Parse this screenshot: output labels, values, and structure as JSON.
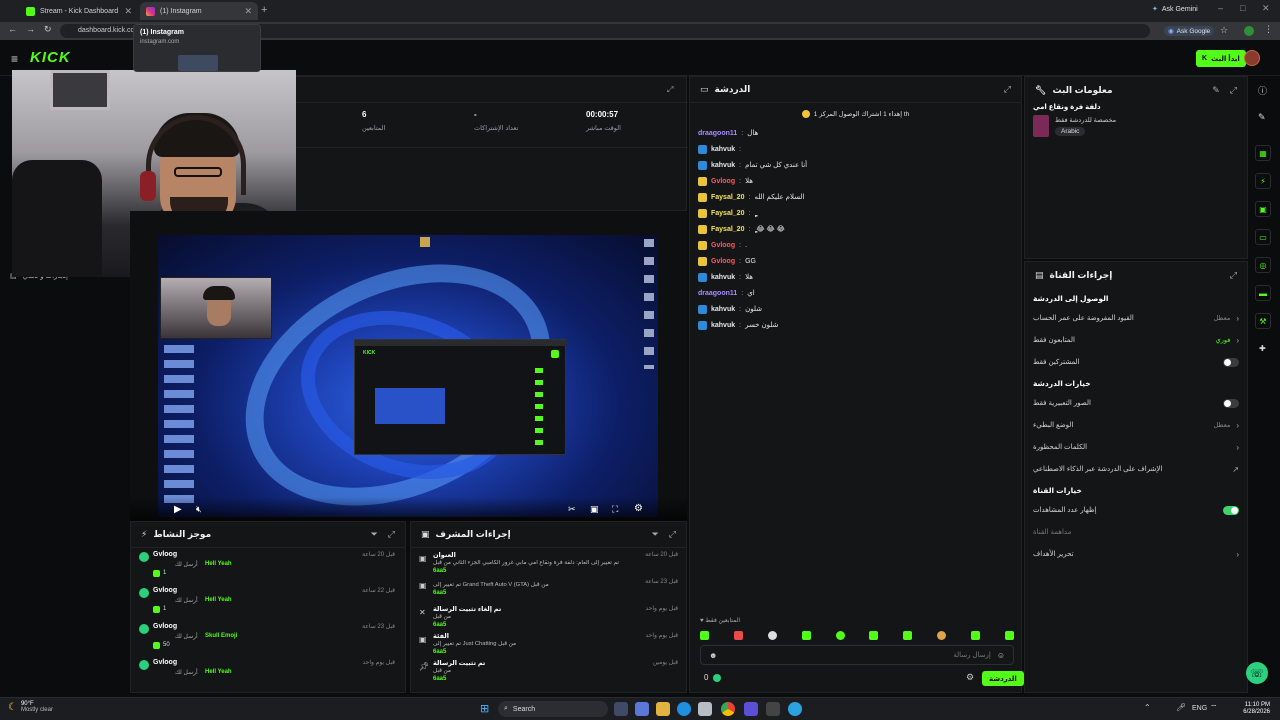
{
  "browser": {
    "tabs": [
      {
        "label": "Stream - Kick Dashboard",
        "active": false
      },
      {
        "label": "(1) Instagram",
        "active": true
      }
    ],
    "url": "dashboard.kick.co",
    "ask_gemini": "Ask Gemini",
    "ask_google": "Ask Google",
    "tooltip": {
      "title": "(1) Instagram",
      "domain": "instagram.com"
    }
  },
  "kick": {
    "logo": "KICK",
    "go_live_label": "ابدأ البث",
    "stats": [
      {
        "value": "00:00:57",
        "label": "الوقت مباشر"
      },
      {
        "value": "-",
        "label": "تعداد الإشتراكات"
      },
      {
        "value": "6",
        "label": "المتابعين"
      }
    ],
    "left_menu_item": "إنجازات و تحدي"
  },
  "chat": {
    "title": "الدردشة",
    "pinned": "إهداء 1 اشتراك الوصول المركز 1 th",
    "messages": [
      {
        "user": "draagoon11",
        "text": "هال",
        "color": "#a98bff"
      },
      {
        "user": "kahvuk",
        "text": "",
        "color": "#e6e6e6"
      },
      {
        "user": "kahvuk",
        "text": "أنا عندي كل شي تمام",
        "color": "#e6e6e6"
      },
      {
        "user": "Gvloog",
        "text": "هلا",
        "color": "#ff5a5a"
      },
      {
        "user": "Faysal_20",
        "text": "السلام عليكم الله",
        "color": "#f5e663"
      },
      {
        "user": "Faysal_20",
        "text": "ٍٍٍٍٍٍٍٍٍٍٍ",
        "color": "#f5e663"
      },
      {
        "user": "Faysal_20",
        "text": "ٍٍٍٍٍ 😂 😂 😂",
        "color": "#f5e663"
      },
      {
        "user": "Gvloog",
        "text": ".",
        "color": "#ff5a5a"
      },
      {
        "user": "Gvloog",
        "text": "GG",
        "color": "#ff5a5a"
      },
      {
        "user": "kahvuk",
        "text": "هلا",
        "color": "#e6e6e6"
      },
      {
        "user": "draagoon11",
        "text": "اي",
        "color": "#a98bff"
      },
      {
        "user": "kahvuk",
        "text": "شلون",
        "color": "#e6e6e6"
      },
      {
        "user": "kahvuk",
        "text": "شلون خسر",
        "color": "#e6e6e6"
      }
    ],
    "followers_only": "المتابعين فقط",
    "input_placeholder": "إرسال رسالة",
    "send_label": "الدردشة",
    "count": "0"
  },
  "stream_info": {
    "title": "معلومات البث",
    "stream_title": "دلفة فرة ونقاع امي",
    "category": "مخصصة للدردشة فقط",
    "language": "Arabic"
  },
  "channel_actions": {
    "title": "إجراءات القناة",
    "sections": [
      {
        "heading": "الوصول إلى الدردشة",
        "rows": [
          {
            "label": "القيود المفروضة على عمر الحساب",
            "value": "معطل",
            "type": "arrow"
          },
          {
            "label": "المتابعون فقط",
            "value": "فوري",
            "type": "arrow-green"
          },
          {
            "label": "المشتركين فقط",
            "value": "",
            "type": "toggle-off"
          }
        ]
      },
      {
        "heading": "خيارات الدردشة",
        "rows": [
          {
            "label": "الصور التعبيرية فقط",
            "value": "",
            "type": "toggle-off"
          },
          {
            "label": "الوضع البطيء",
            "value": "معطل",
            "type": "arrow"
          },
          {
            "label": "الكلمات المحظورة",
            "value": "",
            "type": "arrow"
          },
          {
            "label": "الإشراف على الدردشة عبر الذكاء الاصطناعي",
            "value": "",
            "type": "ext"
          }
        ]
      },
      {
        "heading": "خيارات القناة",
        "rows": [
          {
            "label": "إظهار عدد المشاهدات",
            "value": "",
            "type": "toggle-on"
          },
          {
            "label": "مداهمة القناة",
            "value": "",
            "type": "muted"
          },
          {
            "label": "تحرير الأهداف",
            "value": "",
            "type": "arrow"
          }
        ]
      }
    ]
  },
  "activity": {
    "title": "موجز النشاط",
    "items": [
      {
        "user": "Gvloog",
        "action": "أرسل لك",
        "item": "Hell Yeah",
        "count": "1",
        "time": "قبل 20 ساعة"
      },
      {
        "user": "Gvloog",
        "action": "أرسل لك",
        "item": "Hell Yeah",
        "count": "1",
        "time": "قبل 22 ساعة"
      },
      {
        "user": "Gvloog",
        "action": "أرسل لك",
        "item": "Skull Emoji",
        "count": "50",
        "time": "قبل 23 ساعة"
      },
      {
        "user": "Gvloog",
        "action": "أرسل لك",
        "item": "Hell Yeah",
        "count": "",
        "time": "قبل يوم واحد"
      }
    ]
  },
  "mod_actions": {
    "title": "إجراءات المشرف",
    "items": [
      {
        "head": "العنوان",
        "detail": "تم تغيير إلى العام: دلفة فرة ونقاع امي مابي غرور الكامبي الجزء الثاني من قبل",
        "by": "6aa5",
        "time": "قبل 20 ساعة"
      },
      {
        "head": "",
        "detail": "تم تغيير إلى Grand Theft Auto V (GTA) من قبل",
        "by": "6aa5",
        "time": "قبل 23 ساعة"
      },
      {
        "head": "تم إلغاء تثبيت الرسالة",
        "detail": "من قبل",
        "by": "6aa5",
        "time": "قبل يوم واحد"
      },
      {
        "head": "الفئة",
        "detail": "تم تغيير إلى Just Chatting من قبل",
        "by": "6aa5",
        "time": "قبل يوم واحد"
      },
      {
        "head": "تم تثبيت الرسالة",
        "detail": "من قبل",
        "by": "6aa5",
        "time": "قبل يومين"
      }
    ]
  },
  "taskbar": {
    "weather_temp": "90°F",
    "weather_desc": "Mostly clear",
    "search": "Search",
    "lang": "ENG",
    "time": "11:10 PM",
    "date": "6/28/2026"
  },
  "colors": {
    "accent": "#53fc18",
    "panel": "#141517",
    "bg": "#0b0c0d"
  }
}
